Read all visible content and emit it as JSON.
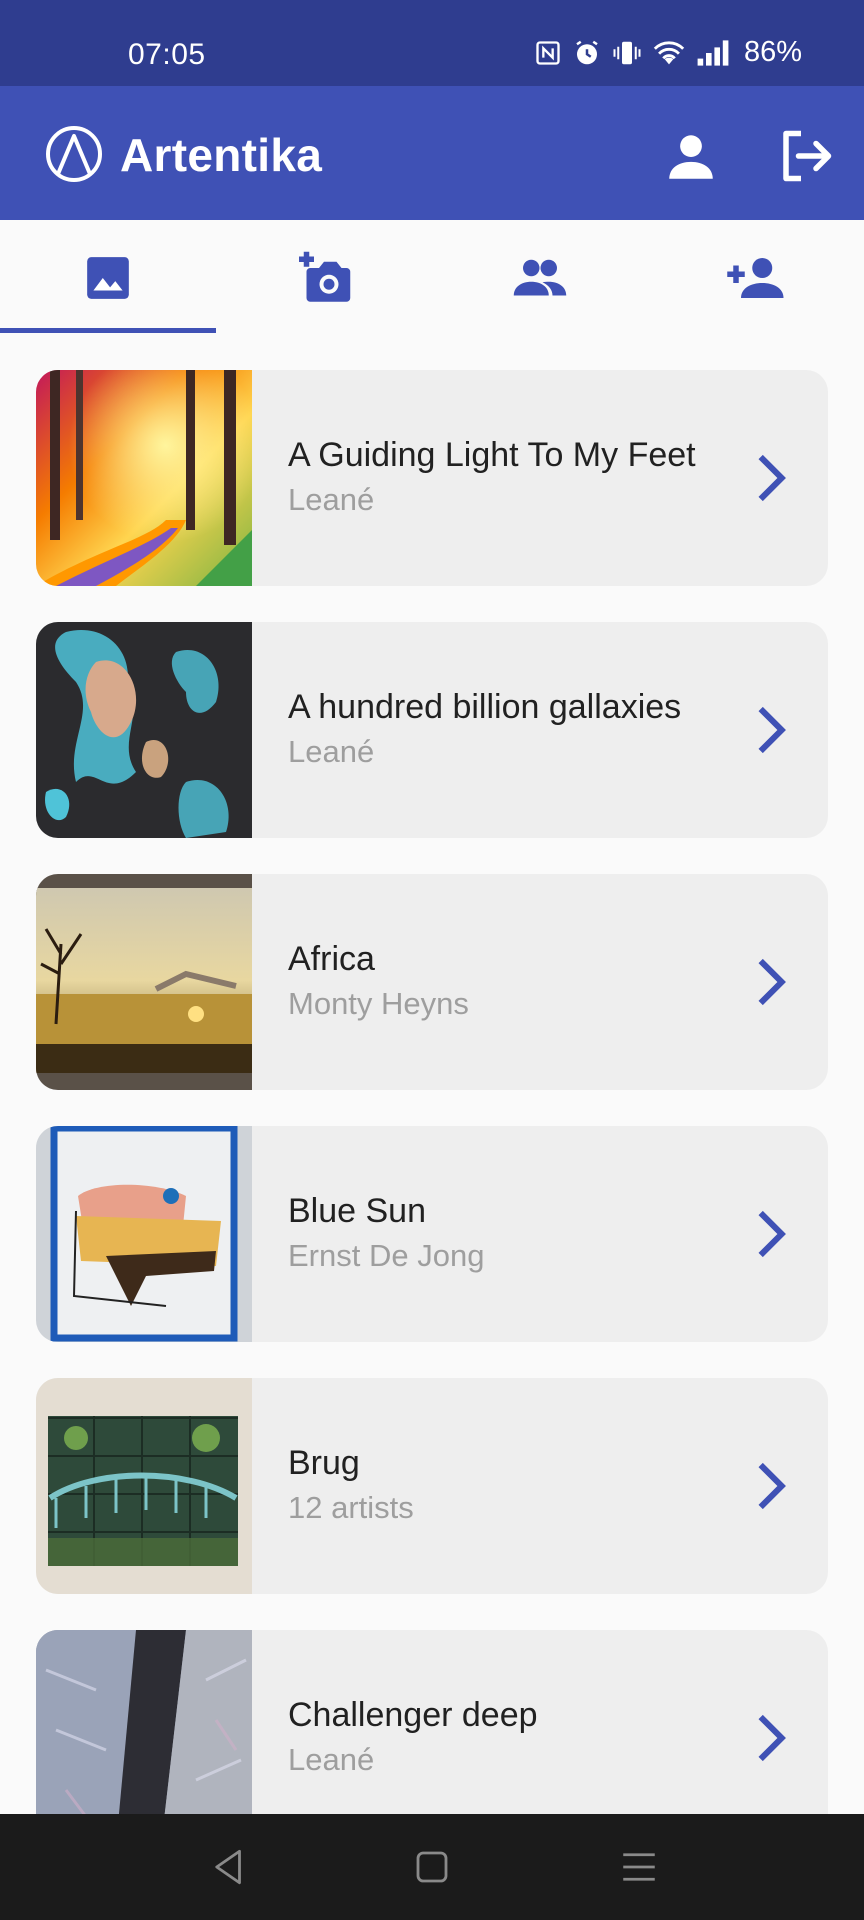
{
  "status": {
    "time": "07:05",
    "battery": "86%"
  },
  "app": {
    "title": "Artentika"
  },
  "tabs": [
    {
      "name": "gallery",
      "icon": "image-icon",
      "active": true
    },
    {
      "name": "add-artwork",
      "icon": "add-camera-icon",
      "active": false
    },
    {
      "name": "artists",
      "icon": "group-icon",
      "active": false
    },
    {
      "name": "add-artist",
      "icon": "person-add-icon",
      "active": false
    }
  ],
  "artworks": [
    {
      "title": "A Guiding Light To My Feet",
      "artist": "Leané"
    },
    {
      "title": "A hundred billion gallaxies",
      "artist": "Leané"
    },
    {
      "title": "Africa",
      "artist": "Monty Heyns"
    },
    {
      "title": "Blue Sun",
      "artist": "Ernst De Jong"
    },
    {
      "title": "Brug",
      "artist": "12 artists"
    },
    {
      "title": "Challenger deep",
      "artist": "Leané"
    }
  ],
  "colors": {
    "primary": "#3f51b5",
    "status_bar": "#2f3d8f",
    "card": "#eeeeee",
    "subtitle": "#9e9e9e"
  }
}
